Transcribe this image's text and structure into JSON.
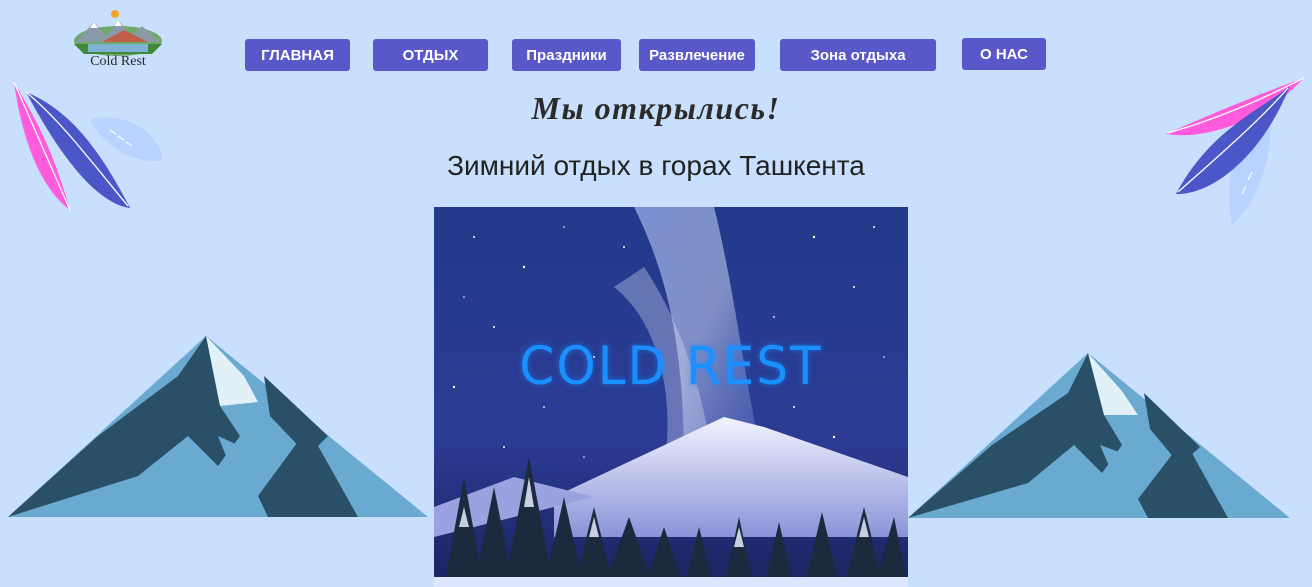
{
  "brand": {
    "logo_text": "Cold Rest"
  },
  "nav": {
    "items": [
      {
        "label": "ГЛАВНАЯ"
      },
      {
        "label": "ОТДЫХ"
      },
      {
        "label": "Праздники"
      },
      {
        "label": "Развлечение"
      },
      {
        "label": "Зона отдыха"
      },
      {
        "label": "О НАС"
      }
    ]
  },
  "hero": {
    "headline": "Мы открылись!",
    "subheadline": "Зимний отдых в горах Ташкента",
    "image_text": "COLD REST"
  },
  "colors": {
    "background": "#c8dffd",
    "nav_button": "#5a57c8",
    "mountain_dark": "#2a5068",
    "mountain_light": "#6aa9d0",
    "leaf_pink": "#ff5bdc",
    "leaf_blue": "#4b56c8"
  }
}
